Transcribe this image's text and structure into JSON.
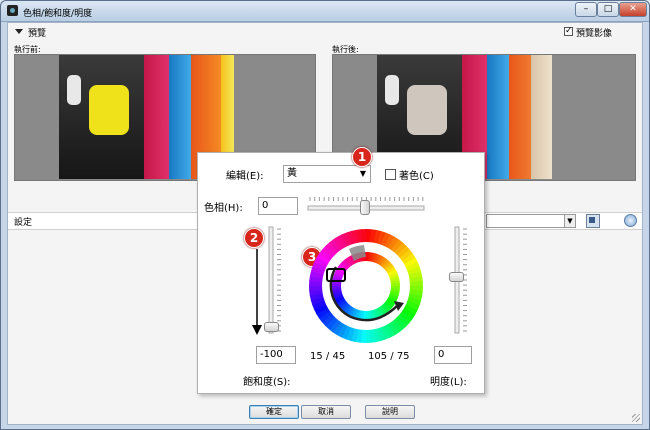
{
  "window": {
    "title": "色相/飽和度/明度"
  },
  "preview": {
    "section_label": "預覽",
    "preview_image_label": "預覽影像",
    "preview_image_checked": true,
    "before_label": "執行前:",
    "after_label": "執行後:"
  },
  "settings": {
    "label": "設定"
  },
  "adjust": {
    "edit_label": "編輯(E):",
    "edit_value": "黃",
    "colorize_label": "著色(C)",
    "colorize_checked": false,
    "hue_label": "色相(H):",
    "hue_value": "0",
    "hue_level": 0.49,
    "saturation_label": "飽和度(S):",
    "saturation_value": "-100",
    "saturation_level": 0.0,
    "lightness_label": "明度(L):",
    "lightness_value": "0",
    "lightness_level": 0.5,
    "range_left": "15 / 45",
    "range_right": "105 / 75"
  },
  "annotations": [
    "1",
    "2",
    "3"
  ],
  "buttons": {
    "ok": "確定",
    "cancel": "取消",
    "help": "說明"
  },
  "colors": {
    "badge": "#d8261d",
    "titlebar": "#c6d6e8",
    "fabric_red": "#c81e4a",
    "fabric_blue": "#1e8ed6",
    "fabric_orange": "#f26a16",
    "fabric_yellow": "#f2e21c"
  }
}
